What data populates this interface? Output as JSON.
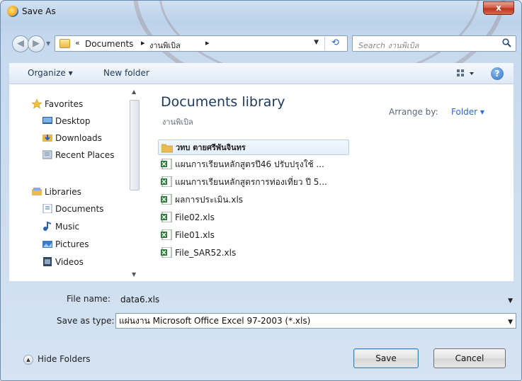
{
  "window": {
    "title": "Save As",
    "close_label": "x"
  },
  "nav": {
    "breadcrumb": [
      "Documents",
      "งานพิเบิล"
    ],
    "breadcrumb_prefix": "«",
    "search_placeholder": "Search งานพิเบิล"
  },
  "toolbar": {
    "organize_label": "Organize ▾",
    "new_folder_label": "New folder",
    "help_label": "?"
  },
  "sidebar": {
    "favorites_label": "Favorites",
    "favorites": [
      "Desktop",
      "Downloads",
      "Recent Places"
    ],
    "libraries_label": "Libraries",
    "libraries": [
      "Documents",
      "Music",
      "Pictures",
      "Videos"
    ]
  },
  "library": {
    "title": "Documents library",
    "subtitle": "งานพิเบิล",
    "arrange_label": "Arrange by:",
    "arrange_value": "Folder ▾"
  },
  "files": [
    {
      "name": "วทบ ตายศรีพันจินทร",
      "type": "folder",
      "selected": true
    },
    {
      "name": "แผนการเรียนหลักสูตรปี46  ปรับปรุงใช้ ...",
      "type": "excel"
    },
    {
      "name": "แผนการเรียนหลักสูตรการท่องเที่ยว ปี 5...",
      "type": "excel"
    },
    {
      "name": "ผลการประเมิน.xls",
      "type": "excel"
    },
    {
      "name": "File02.xls",
      "type": "excel"
    },
    {
      "name": "File01.xls",
      "type": "excel"
    },
    {
      "name": "File_SAR52.xls",
      "type": "excel"
    }
  ],
  "form": {
    "filename_label": "File name:",
    "filename_value": "data6.xls",
    "savetype_label": "Save as type:",
    "savetype_value": "แผ่นงาน Microsoft Office Excel 97-2003 (*.xls)"
  },
  "footer": {
    "hide_folders_label": "Hide Folders",
    "save_label": "Save",
    "cancel_label": "Cancel"
  },
  "colors": {
    "accent": "#2c6ad1",
    "title_blue": "#1e395b",
    "close_red": "#c8432a"
  }
}
